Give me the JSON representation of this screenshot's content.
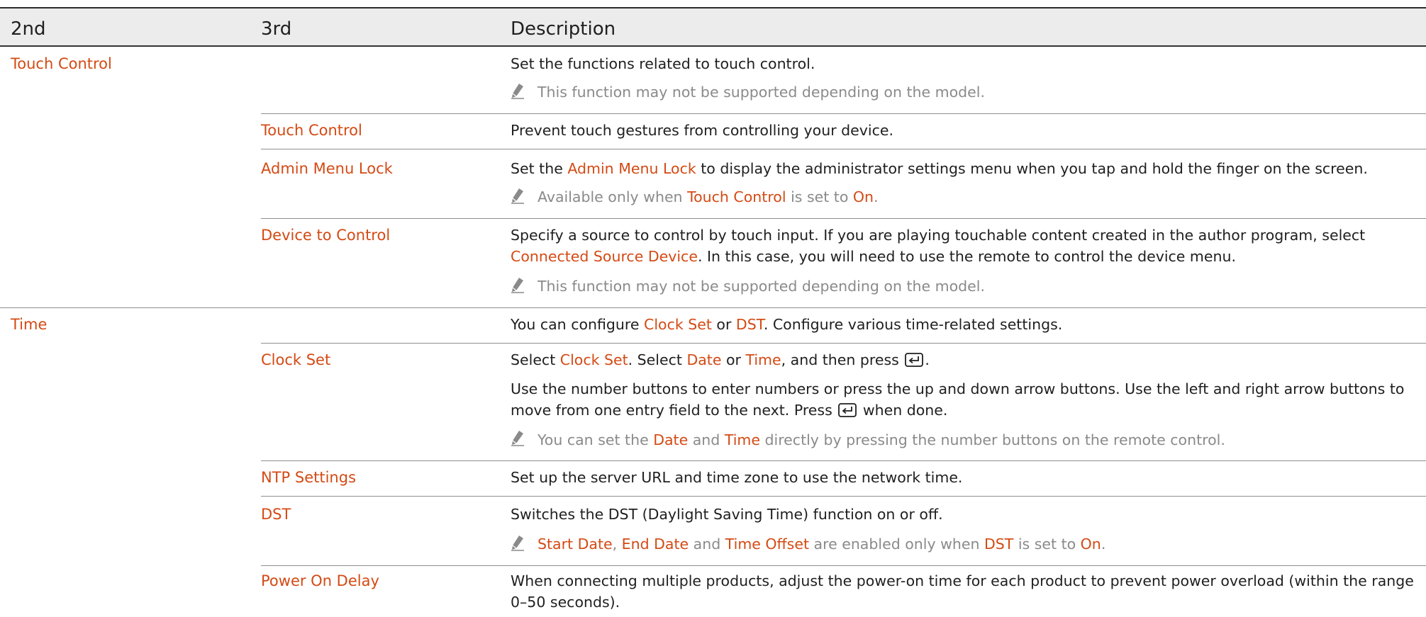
{
  "header": {
    "col1": "2nd",
    "col2": "3rd",
    "col3": "Description"
  },
  "touch": {
    "label": "Touch Control",
    "desc": "Set the functions related to touch control.",
    "note": "This function may not be supported depending on the model.",
    "tc": {
      "label": "Touch Control",
      "desc": "Prevent touch gestures from controlling your device."
    },
    "aml": {
      "label": "Admin Menu Lock",
      "d_pre": "Set the ",
      "d_hl": "Admin Menu Lock",
      "d_post": " to display the administrator settings menu when you tap and hold the finger on the screen.",
      "n_pre": "Available only when ",
      "n_hl1": "Touch Control",
      "n_mid": " is set to ",
      "n_hl2": "On",
      "n_post": "."
    },
    "dtc": {
      "label": "Device to Control",
      "line1": "Specify a source to control by touch input. If you are playing touchable content created in the author program, select",
      "line2_hl": "Connected Source Device",
      "line2_post": ". In this case, you will need to use the remote to control the device menu.",
      "note": "This function may not be supported depending on the model."
    }
  },
  "time": {
    "label": "Time",
    "d_pre": "You can configure ",
    "d_hl1": "Clock Set",
    "d_mid": " or ",
    "d_hl2": "DST",
    "d_post": ". Configure various time-related settings.",
    "clock": {
      "label": "Clock Set",
      "l1_pre": "Select ",
      "l1_hl1": "Clock Set",
      "l1_mid1": ". Select ",
      "l1_hl2": "Date",
      "l1_mid2": " or ",
      "l1_hl3": "Time",
      "l1_post": ", and then press",
      "l1_end": ".",
      "l2": "Use the number buttons to enter numbers or press the up and down arrow buttons. Use the left and right arrow buttons to",
      "l3_pre": "move from one entry field to the next. Press",
      "l3_post": "when done.",
      "n_pre": "You can set the ",
      "n_hl1": "Date",
      "n_mid": " and ",
      "n_hl2": "Time",
      "n_post": " directly by pressing the number buttons on the remote control."
    },
    "ntp": {
      "label": "NTP Settings",
      "desc": "Set up the server URL and time zone to use the network time."
    },
    "dst": {
      "label": "DST",
      "desc": "Switches the DST (Daylight Saving Time) function on or off.",
      "n_hl1": "Start Date",
      "n_s1": ", ",
      "n_hl2": "End Date",
      "n_s2": " and ",
      "n_hl3": "Time Offset",
      "n_s3": " are enabled only when ",
      "n_hl4": "DST",
      "n_s4": " is set to ",
      "n_hl5": "On",
      "n_s5": "."
    },
    "pod": {
      "label": "Power On Delay",
      "l1": "When connecting multiple products, adjust the power-on time for each product to prevent power overload (within the range",
      "l2": "0–50 seconds)."
    }
  },
  "icons": {
    "note": "pencil-icon",
    "enter": "enter-key-icon"
  },
  "colors": {
    "accent": "#d44a14",
    "note": "#8a8a8a",
    "header_bg": "#ececec"
  }
}
